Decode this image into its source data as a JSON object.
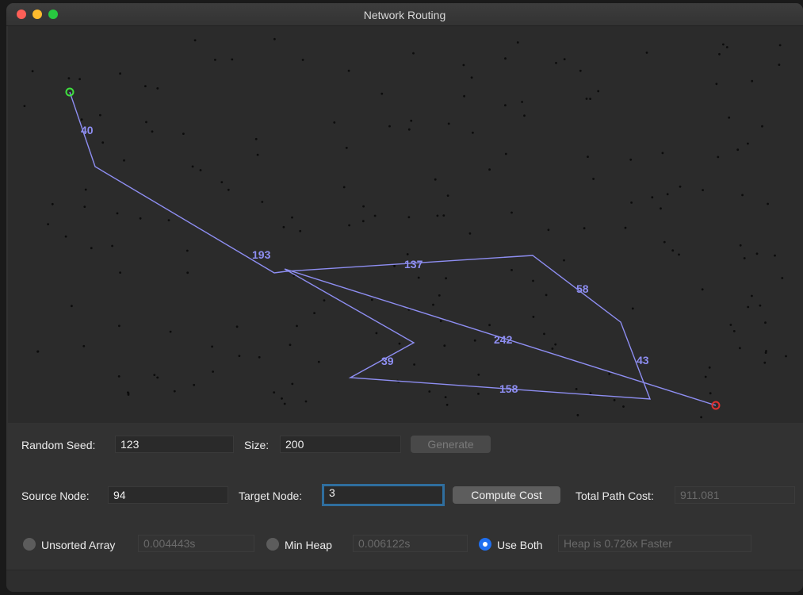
{
  "window": {
    "title": "Network Routing",
    "lights": [
      "#fe5f57",
      "#febb2e",
      "#28c840"
    ]
  },
  "graph": {
    "edge_color": "#8e8ef2",
    "source_color": "#3fe03f",
    "target_color": "#e03030",
    "edge_labels": [
      "40",
      "193",
      "137",
      "58",
      "43",
      "242",
      "39",
      "158"
    ]
  },
  "controls": {
    "seed_label": "Random Seed:",
    "seed_value": "123",
    "size_label": "Size:",
    "size_value": "200",
    "generate_label": "Generate",
    "source_label": "Source Node:",
    "source_value": "94",
    "target_label": "Target Node:",
    "target_value": "3",
    "compute_label": "Compute Cost",
    "total_label": "Total Path Cost:",
    "total_value": "911.081"
  },
  "modes": {
    "unsorted_label": "Unsorted Array",
    "unsorted_time": "0.004443s",
    "heap_label": "Min Heap",
    "heap_time": "0.006122s",
    "both_label": "Use Both",
    "both_result": "Heap is 0.726x Faster",
    "selected": "both"
  }
}
